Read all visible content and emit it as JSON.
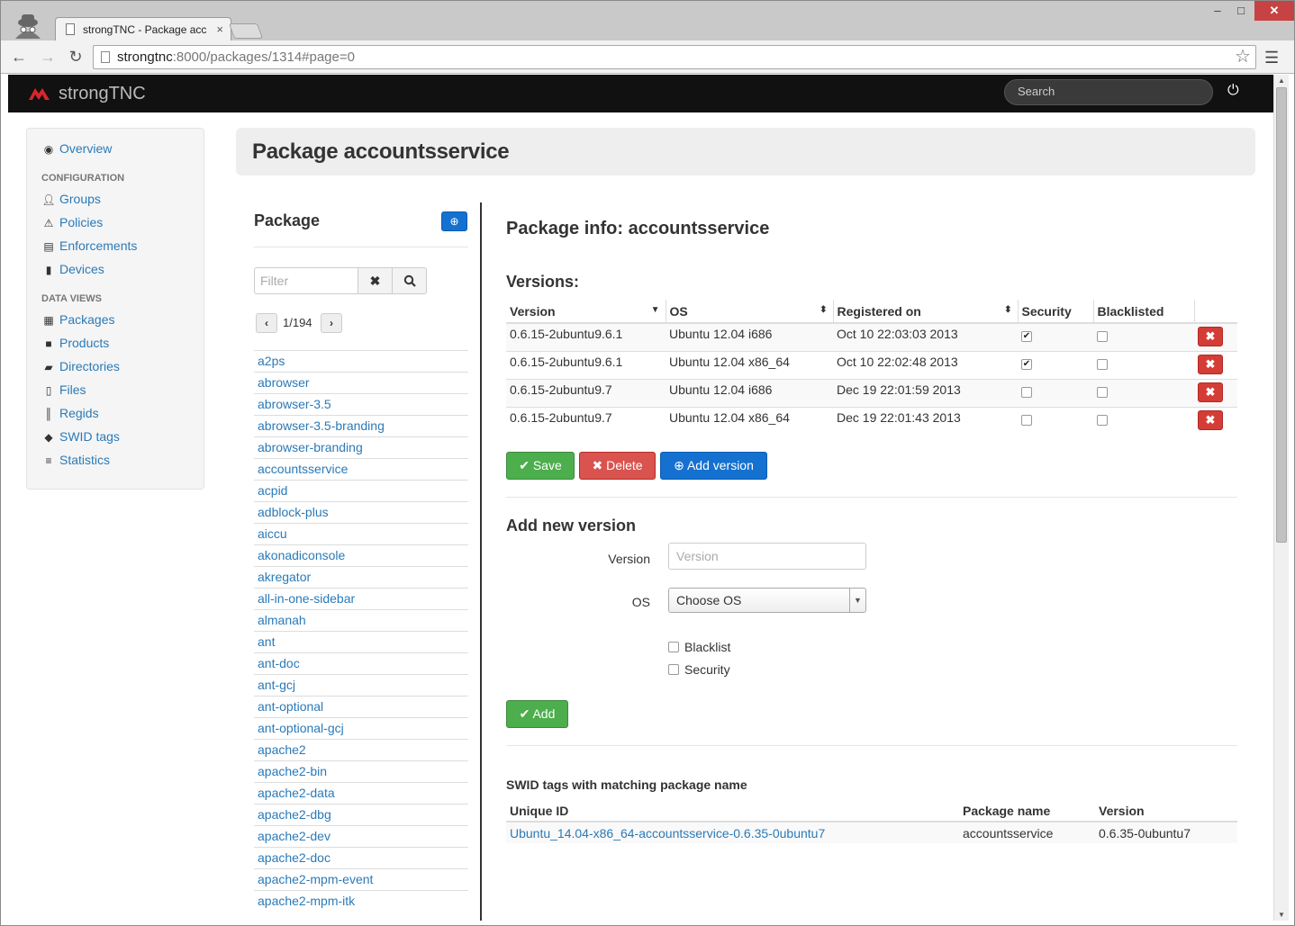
{
  "browser": {
    "tab_title": "strongTNC - Package acc",
    "url_host": "strongtnc",
    "url_rest": ":8000/packages/1314#page=0",
    "window_controls": {
      "min": "–",
      "max": "□",
      "close": "✕"
    }
  },
  "app": {
    "brand": "strongTNC",
    "search_placeholder": "Search",
    "power_icon": "⏻"
  },
  "sidebar": {
    "overview": "Overview",
    "config_heading": "CONFIGURATION",
    "config_items": [
      "Groups",
      "Policies",
      "Enforcements",
      "Devices"
    ],
    "dataviews_heading": "DATA VIEWS",
    "data_items": [
      "Packages",
      "Products",
      "Directories",
      "Files",
      "Regids",
      "SWID tags",
      "Statistics"
    ]
  },
  "page_title": "Package accountsservice",
  "package_list": {
    "heading": "Package",
    "filter_placeholder": "Filter",
    "pager": "1/194",
    "items": [
      "a2ps",
      "abrowser",
      "abrowser-3.5",
      "abrowser-3.5-branding",
      "abrowser-branding",
      "accountsservice",
      "acpid",
      "adblock-plus",
      "aiccu",
      "akonadiconsole",
      "akregator",
      "all-in-one-sidebar",
      "almanah",
      "ant",
      "ant-doc",
      "ant-gcj",
      "ant-optional",
      "ant-optional-gcj",
      "apache2",
      "apache2-bin",
      "apache2-data",
      "apache2-dbg",
      "apache2-dev",
      "apache2-doc",
      "apache2-mpm-event",
      "apache2-mpm-itk"
    ]
  },
  "package_info": {
    "title": "Package info: accountsservice",
    "versions_heading": "Versions:",
    "columns": [
      "Version",
      "OS",
      "Registered on",
      "Security",
      "Blacklisted"
    ],
    "rows": [
      {
        "version": "0.6.15-2ubuntu9.6.1",
        "os": "Ubuntu 12.04 i686",
        "registered": "Oct 10 22:03:03 2013",
        "security": true,
        "blacklisted": false
      },
      {
        "version": "0.6.15-2ubuntu9.6.1",
        "os": "Ubuntu 12.04 x86_64",
        "registered": "Oct 10 22:02:48 2013",
        "security": true,
        "blacklisted": false
      },
      {
        "version": "0.6.15-2ubuntu9.7",
        "os": "Ubuntu 12.04 i686",
        "registered": "Dec 19 22:01:59 2013",
        "security": false,
        "blacklisted": false
      },
      {
        "version": "0.6.15-2ubuntu9.7",
        "os": "Ubuntu 12.04 x86_64",
        "registered": "Dec 19 22:01:43 2013",
        "security": false,
        "blacklisted": false
      }
    ],
    "buttons": {
      "save": "Save",
      "delete": "Delete",
      "add_version": "Add version"
    }
  },
  "add_form": {
    "heading": "Add new version",
    "version_label": "Version",
    "version_placeholder": "Version",
    "os_label": "OS",
    "os_value": "Choose OS",
    "blacklist_label": "Blacklist",
    "security_label": "Security",
    "add_button": "Add"
  },
  "swid": {
    "heading": "SWID tags with matching package name",
    "columns": [
      "Unique ID",
      "Package name",
      "Version"
    ],
    "rows": [
      {
        "unique_id": "Ubuntu_14.04-x86_64-accountsservice-0.6.35-0ubuntu7",
        "package_name": "accountsservice",
        "version": "0.6.35-0ubuntu7"
      }
    ]
  }
}
